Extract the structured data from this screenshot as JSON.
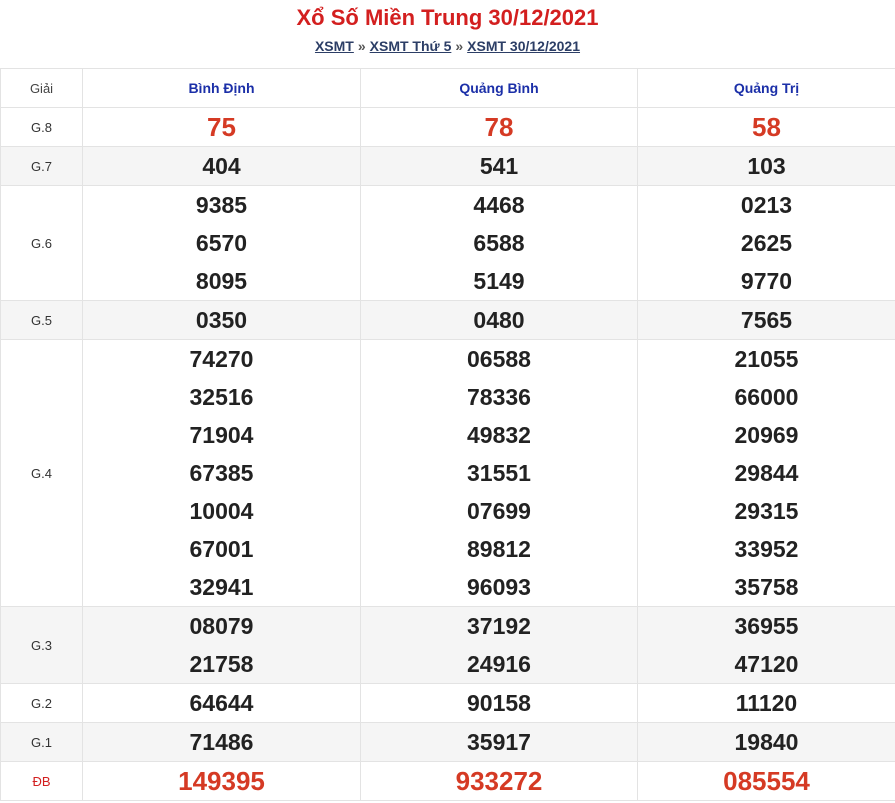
{
  "header": {
    "title": "Xổ Số Miền Trung 30/12/2021",
    "breadcrumbs": [
      "XSMT",
      "XSMT Thứ 5",
      "XSMT 30/12/2021"
    ],
    "separator": "»"
  },
  "table": {
    "label_header": "Giải",
    "provinces": [
      "Bình Định",
      "Quảng Bình",
      "Quảng Trị"
    ],
    "rows": [
      {
        "label": "G.8",
        "values": [
          [
            "75"
          ],
          [
            "78"
          ],
          [
            "58"
          ]
        ],
        "highlight": true
      },
      {
        "label": "G.7",
        "values": [
          [
            "404"
          ],
          [
            "541"
          ],
          [
            "103"
          ]
        ]
      },
      {
        "label": "G.6",
        "values": [
          [
            "9385",
            "6570",
            "8095"
          ],
          [
            "4468",
            "6588",
            "5149"
          ],
          [
            "0213",
            "2625",
            "9770"
          ]
        ]
      },
      {
        "label": "G.5",
        "values": [
          [
            "0350"
          ],
          [
            "0480"
          ],
          [
            "7565"
          ]
        ]
      },
      {
        "label": "G.4",
        "values": [
          [
            "74270",
            "32516",
            "71904",
            "67385",
            "10004",
            "67001",
            "32941"
          ],
          [
            "06588",
            "78336",
            "49832",
            "31551",
            "07699",
            "89812",
            "96093"
          ],
          [
            "21055",
            "66000",
            "20969",
            "29844",
            "29315",
            "33952",
            "35758"
          ]
        ]
      },
      {
        "label": "G.3",
        "values": [
          [
            "08079",
            "21758"
          ],
          [
            "37192",
            "24916"
          ],
          [
            "36955",
            "47120"
          ]
        ]
      },
      {
        "label": "G.2",
        "values": [
          [
            "64644"
          ],
          [
            "90158"
          ],
          [
            "11120"
          ]
        ]
      },
      {
        "label": "G.1",
        "values": [
          [
            "71486"
          ],
          [
            "35917"
          ],
          [
            "19840"
          ]
        ]
      },
      {
        "label": "ĐB",
        "values": [
          [
            "149395"
          ],
          [
            "933272"
          ],
          [
            "085554"
          ]
        ],
        "highlight": true
      }
    ]
  },
  "colors": {
    "title": "#d31f1f",
    "highlight_number": "#d53a24",
    "province": "#1b2fa8"
  }
}
